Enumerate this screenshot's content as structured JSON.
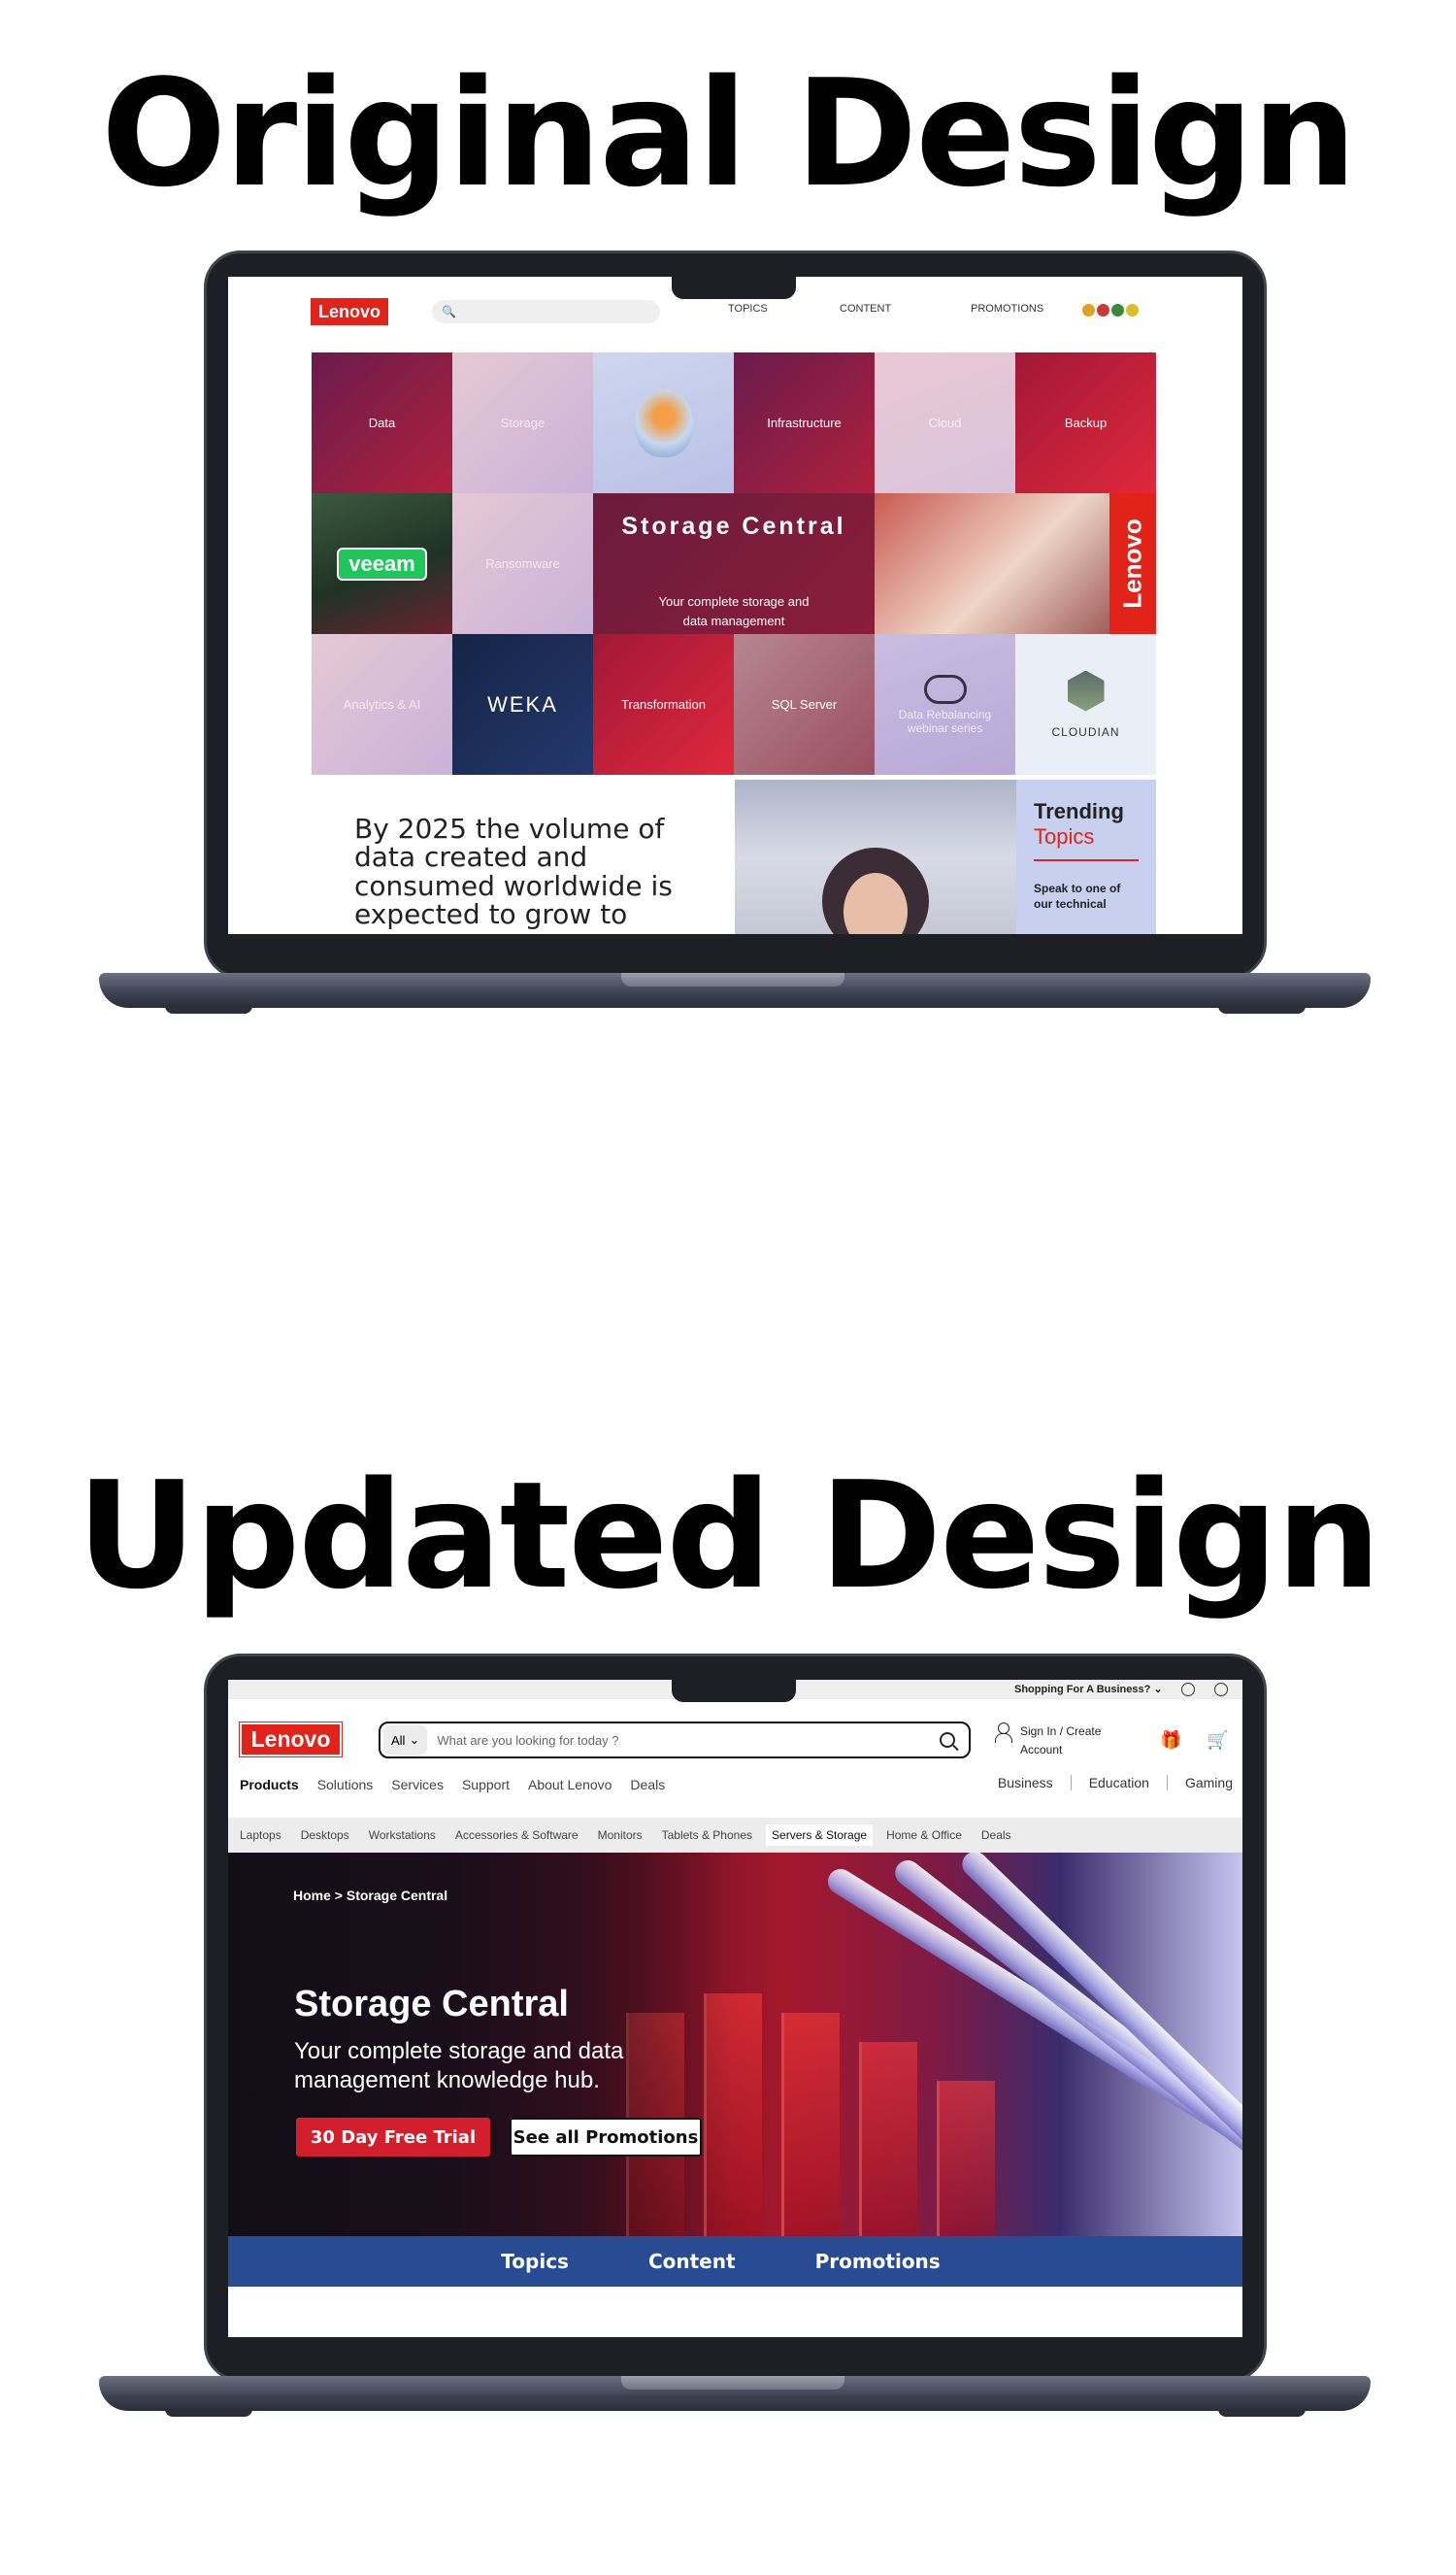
{
  "headings": {
    "original": "Original Design",
    "updated": "Updated Design"
  },
  "original": {
    "logo": "Lenovo",
    "nav": [
      "TOPICS",
      "CONTENT",
      "PROMOTIONS"
    ],
    "tiles": {
      "data": "Data",
      "storage": "Storage",
      "infrastructure": "Infrastructure",
      "cloud": "Cloud",
      "backup": "Backup",
      "veeam": "veeam",
      "ransomware": "Ransomware",
      "hero_title": "Storage Central",
      "hero_sub": "Your complete storage and data management",
      "vertical_logo": "Lenovo",
      "analytics": "Analytics & AI",
      "weka": "WEKA",
      "transformation": "Transformation",
      "sql": "SQL Server",
      "data_rebalancing": "Data Rebalancing webinar series",
      "cloudian": "CLOUDIAN"
    },
    "stat_text": "By 2025 the volume of data created and consumed worldwide is expected to grow to",
    "trending": {
      "line1": "Trending",
      "line2": "Topics",
      "cta": "Speak to one of our technical"
    },
    "flag_colors": [
      "#e0a020",
      "#c83a3a",
      "#3a8a3a",
      "#d8c02a"
    ]
  },
  "updated": {
    "topbar": {
      "business": "Shopping For A Business? ⌄"
    },
    "logo": "Lenovo",
    "search": {
      "scope": "All",
      "placeholder": "What are you looking for today ?"
    },
    "account": {
      "line1": "Sign In / Create",
      "line2": "Account"
    },
    "nav": [
      "Products",
      "Solutions",
      "Services",
      "Support",
      "About Lenovo",
      "Deals"
    ],
    "nav_right": [
      "Business",
      "Education",
      "Gaming"
    ],
    "categories": [
      "Laptops",
      "Desktops",
      "Workstations",
      "Accessories & Software",
      "Monitors",
      "Tablets & Phones",
      "Servers & Storage",
      "Home & Office",
      "Deals"
    ],
    "hero": {
      "breadcrumb": "Home > Storage Central",
      "title": "Storage Central",
      "subtitle": "Your complete storage and data management knowledge hub.",
      "primary_button": "30 Day Free Trial",
      "secondary_button": "See all Promotions"
    },
    "tabs": [
      "Topics",
      "Content",
      "Promotions"
    ],
    "accent_colors": {
      "lenovo_red": "#e2231a",
      "tab_blue": "#294b94"
    }
  }
}
